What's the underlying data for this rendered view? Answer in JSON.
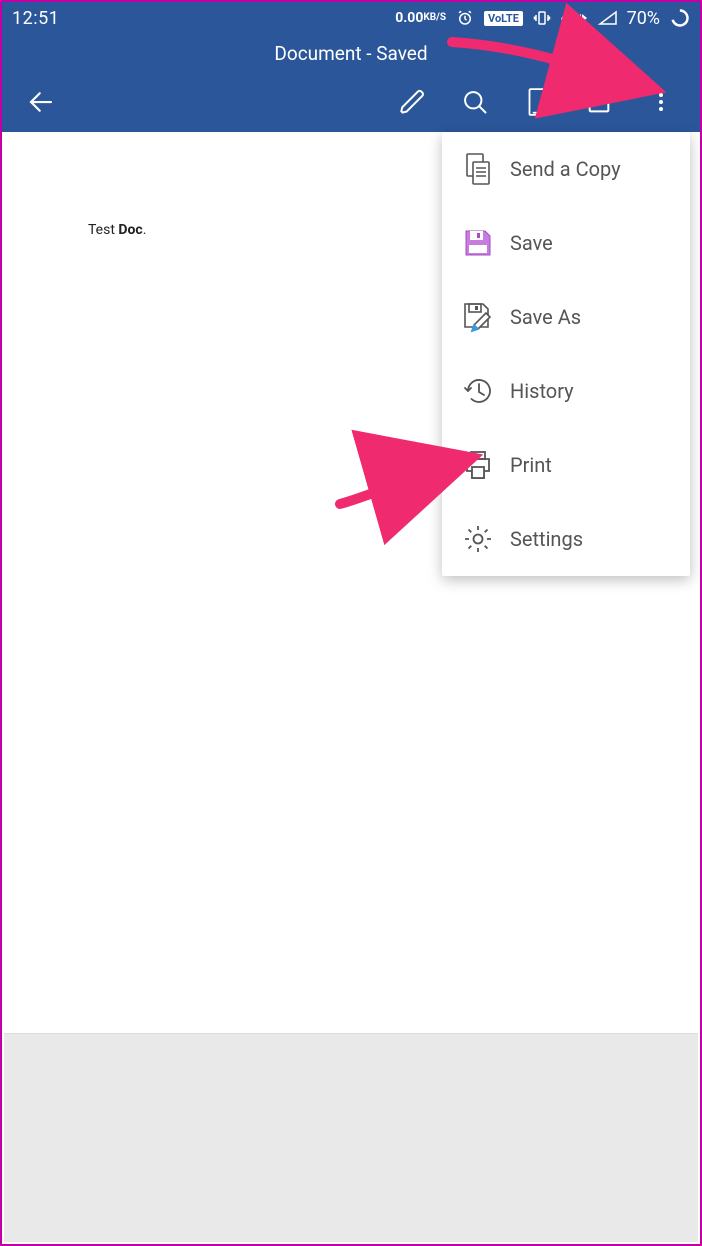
{
  "statusbar": {
    "time": "12:51",
    "data_rate_value": "0.00",
    "data_rate_unit": "KB/S",
    "volte": "VoLTE",
    "network": "4G",
    "battery": "70%"
  },
  "titlebar": {
    "text": "Document - Saved"
  },
  "toolbar": {
    "icons": {
      "back": "back-icon",
      "edit": "pencil-icon",
      "search": "search-icon",
      "reading": "reading-view-icon",
      "share": "share-icon",
      "overflow": "overflow-icon"
    }
  },
  "document": {
    "line_prefix": "Test ",
    "line_bold": "Doc",
    "line_suffix": "."
  },
  "menu": {
    "items": [
      {
        "icon": "copy-icon",
        "label": "Send a Copy"
      },
      {
        "icon": "save-icon",
        "label": "Save"
      },
      {
        "icon": "save-as-icon",
        "label": "Save As"
      },
      {
        "icon": "history-icon",
        "label": "History"
      },
      {
        "icon": "print-icon",
        "label": "Print"
      },
      {
        "icon": "settings-icon",
        "label": "Settings"
      }
    ]
  },
  "annotation": {
    "color": "#ef2a6f"
  }
}
